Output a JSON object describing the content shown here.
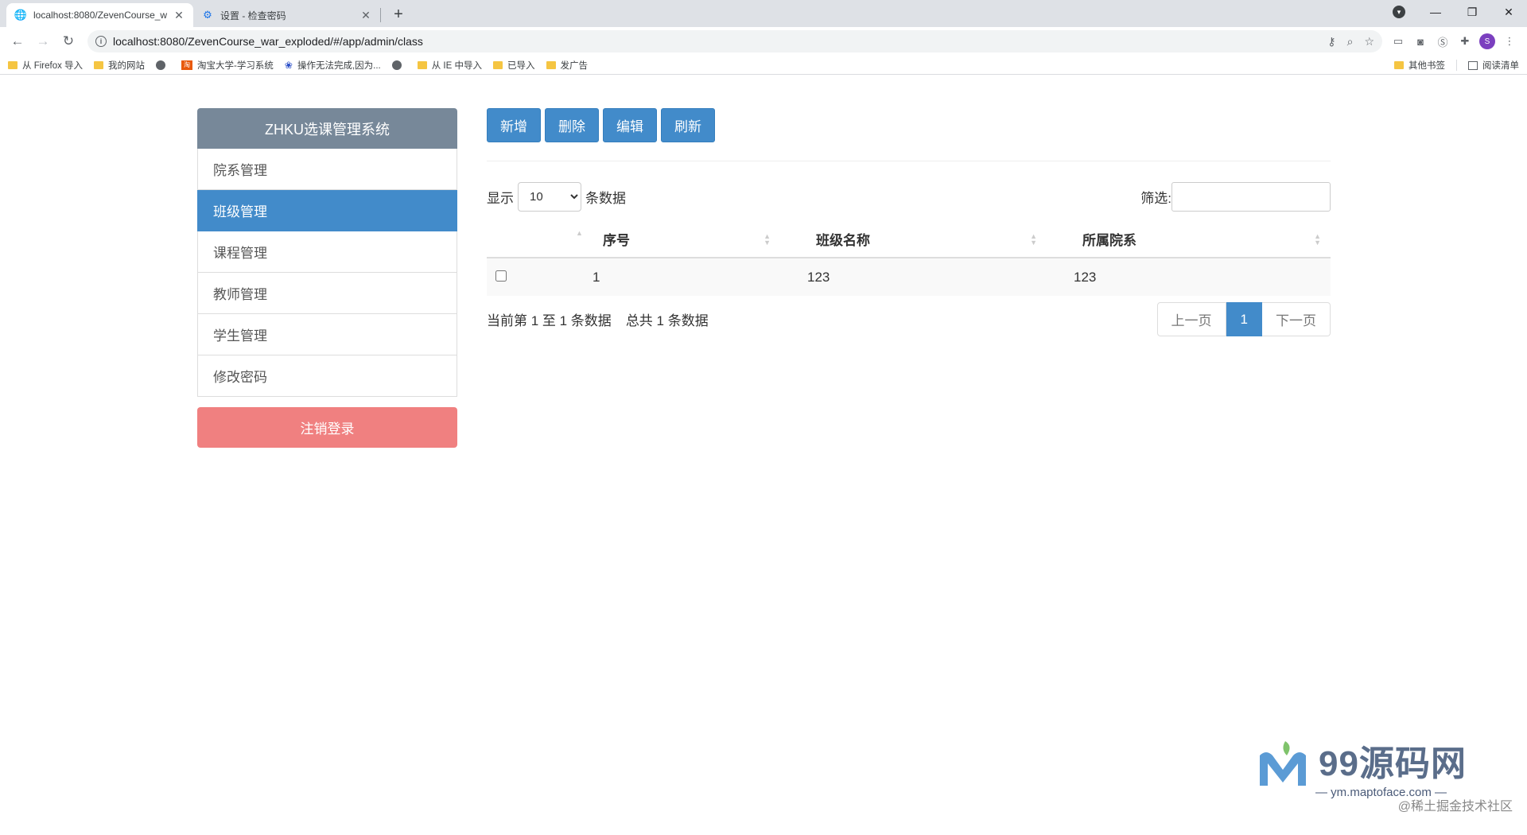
{
  "browser": {
    "tabs": [
      {
        "title": "localhost:8080/ZevenCourse_w",
        "active": true
      },
      {
        "title": "设置 - 检查密码",
        "active": false
      }
    ],
    "url": "localhost:8080/ZevenCourse_war_exploded/#/app/admin/class",
    "avatar_letter": "S",
    "bookmarks": [
      {
        "label": "从 Firefox 导入",
        "icon": "folder-icon"
      },
      {
        "label": "我的网站",
        "icon": "folder-icon"
      },
      {
        "label": "",
        "icon": "globe-icon"
      },
      {
        "label": "淘宝大学-学习系统",
        "icon": "taobao-icon"
      },
      {
        "label": "操作无法完成,因为...",
        "icon": "baidu-paw-icon"
      },
      {
        "label": "",
        "icon": "globe-icon"
      },
      {
        "label": "从 IE 中导入",
        "icon": "folder-icon"
      },
      {
        "label": "已导入",
        "icon": "folder-icon"
      },
      {
        "label": "发广告",
        "icon": "folder-icon"
      }
    ],
    "bookmarks_right": {
      "other": "其他书签",
      "reading_list": "阅读清单"
    }
  },
  "sidebar": {
    "brand": "ZHKU选课管理系统",
    "items": [
      {
        "label": "院系管理",
        "active": false
      },
      {
        "label": "班级管理",
        "active": true
      },
      {
        "label": "课程管理",
        "active": false
      },
      {
        "label": "教师管理",
        "active": false
      },
      {
        "label": "学生管理",
        "active": false
      },
      {
        "label": "修改密码",
        "active": false
      }
    ],
    "logout": "注销登录"
  },
  "actions": {
    "add": "新增",
    "delete": "删除",
    "edit": "编辑",
    "refresh": "刷新"
  },
  "datatable": {
    "length_prefix": "显示",
    "length_value": "10",
    "length_suffix": "条数据",
    "filter_label": "筛选:",
    "filter_value": "",
    "columns": [
      "",
      "序号",
      "班级名称",
      "所属院系"
    ],
    "rows": [
      {
        "checked": false,
        "id": "1",
        "class_name": "123",
        "department": "123"
      }
    ],
    "info_range": "当前第 1 至 1 条数据",
    "info_total": "总共 1 条数据",
    "pagination": {
      "prev": "上一页",
      "current": "1",
      "next": "下一页"
    }
  },
  "watermark": {
    "site_name": "99源码网",
    "site_url": "— ym.maptoface.com —",
    "credit": "@稀土掘金技术社区"
  },
  "colors": {
    "primary": "#428bca",
    "brand_header": "#778899",
    "logout": "#f08080"
  }
}
